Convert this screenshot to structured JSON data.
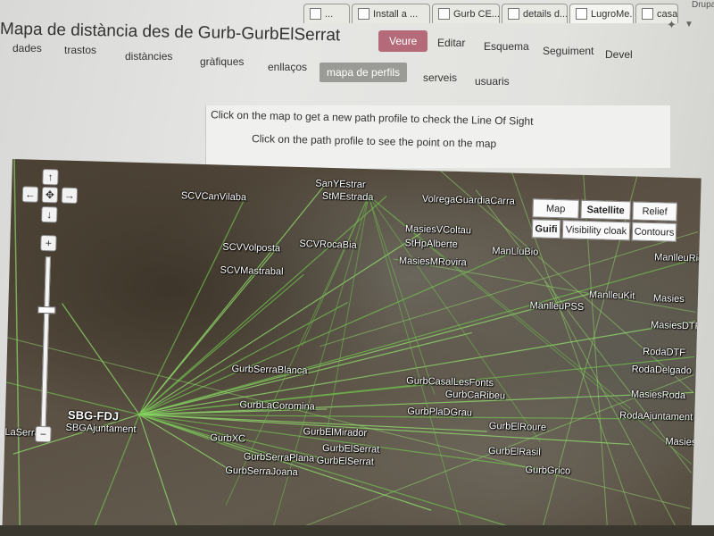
{
  "browser": {
    "tabs": [
      {
        "label": "...",
        "active": false
      },
      {
        "label": "Install a ...",
        "active": false
      },
      {
        "label": "Gurb CE...",
        "active": false
      },
      {
        "label": "details d...",
        "active": false
      },
      {
        "label": "LugroMe...",
        "active": true
      },
      {
        "label": "casa",
        "active": false
      }
    ],
    "user_label": "Drupal"
  },
  "page": {
    "title": "Mapa de distància des de Gurb-GurbElSerrat",
    "view_tabs": [
      {
        "label": "Veure",
        "active": true
      },
      {
        "label": "Editar",
        "active": false
      },
      {
        "label": "Esquema",
        "active": false
      },
      {
        "label": "Seguiment",
        "active": false
      },
      {
        "label": "Devel",
        "active": false
      }
    ],
    "sub_tabs": [
      {
        "label": "dades",
        "active": false
      },
      {
        "label": "trastos",
        "active": false
      },
      {
        "label": "distàncies",
        "active": false
      },
      {
        "label": "gràfiques",
        "active": false
      },
      {
        "label": "enllaços",
        "active": false
      },
      {
        "label": "mapa de perfils",
        "active": true
      },
      {
        "label": "serveis",
        "active": false
      },
      {
        "label": "usuaris",
        "active": false
      }
    ],
    "instructions": [
      "Click on the map to get a new path profile to check the Line Of Sight",
      "Click on the path profile to see the point on the map"
    ]
  },
  "map": {
    "type_buttons": [
      {
        "label": "Map",
        "active": false
      },
      {
        "label": "Satellite",
        "active": true
      },
      {
        "label": "Relief",
        "active": false
      },
      {
        "label": "Guifi",
        "active": true
      },
      {
        "label": "Visibility cloak",
        "active": false
      },
      {
        "label": "Contours",
        "active": false
      }
    ],
    "zoom_level_fraction": 0.3,
    "pan_icons": [
      "arrow-up-icon",
      "arrow-left-icon",
      "center-icon",
      "arrow-right-icon",
      "arrow-down-icon"
    ],
    "nodes": [
      {
        "label": "SBG-FDJ",
        "big": true
      },
      {
        "label": "SBGAjuntament",
        "big": false
      },
      {
        "label": "SCVCanVilaba",
        "big": false
      },
      {
        "label": "SCVVolposta",
        "big": false
      },
      {
        "label": "SCVMastrabal",
        "big": false
      },
      {
        "label": "SCVRocaBia",
        "big": false
      },
      {
        "label": "SanYEstrar",
        "big": false
      },
      {
        "label": "StMEstrada",
        "big": false
      },
      {
        "label": "VolregaGuardiaCarra",
        "big": false
      },
      {
        "label": "MasiesVColtau",
        "big": false
      },
      {
        "label": "StHpAlberte",
        "big": false
      },
      {
        "label": "MasiesMRovira",
        "big": false
      },
      {
        "label": "ManLluBio",
        "big": false
      },
      {
        "label": "ManlleuRig",
        "big": false
      },
      {
        "label": "ManlleuKit",
        "big": false
      },
      {
        "label": "ManlleuPSS",
        "big": false
      },
      {
        "label": "MasiesDTF",
        "big": false
      },
      {
        "label": "RodaDTF",
        "big": false
      },
      {
        "label": "RodaDelgado",
        "big": false
      },
      {
        "label": "MasiesRoda",
        "big": false
      },
      {
        "label": "RodaAjuntament",
        "big": false
      },
      {
        "label": "GurbSerraBlanca",
        "big": false
      },
      {
        "label": "GurbCasalLesFonts",
        "big": false
      },
      {
        "label": "GurbCaRibeu",
        "big": false
      },
      {
        "label": "GurbLaCoromina",
        "big": false
      },
      {
        "label": "GurbPlaDGrau",
        "big": false
      },
      {
        "label": "GurbElRoure",
        "big": false
      },
      {
        "label": "GurbXC",
        "big": false
      },
      {
        "label": "GurbElMirador",
        "big": false
      },
      {
        "label": "GurbElSerrat",
        "big": false
      },
      {
        "label": "GurbElSerrat",
        "big": false
      },
      {
        "label": "GurbSerraPlana",
        "big": false
      },
      {
        "label": "GurbSerraJoana",
        "big": false
      },
      {
        "label": "GurbElRasil",
        "big": false
      },
      {
        "label": "GurbGrico",
        "big": false
      },
      {
        "label": "Masies",
        "big": false
      },
      {
        "label": "LaSerra",
        "big": false
      },
      {
        "label": "Masies",
        "big": false
      }
    ],
    "colors": {
      "link_line": "#8fd86a",
      "link_line_faint": "#6fb84e"
    }
  }
}
